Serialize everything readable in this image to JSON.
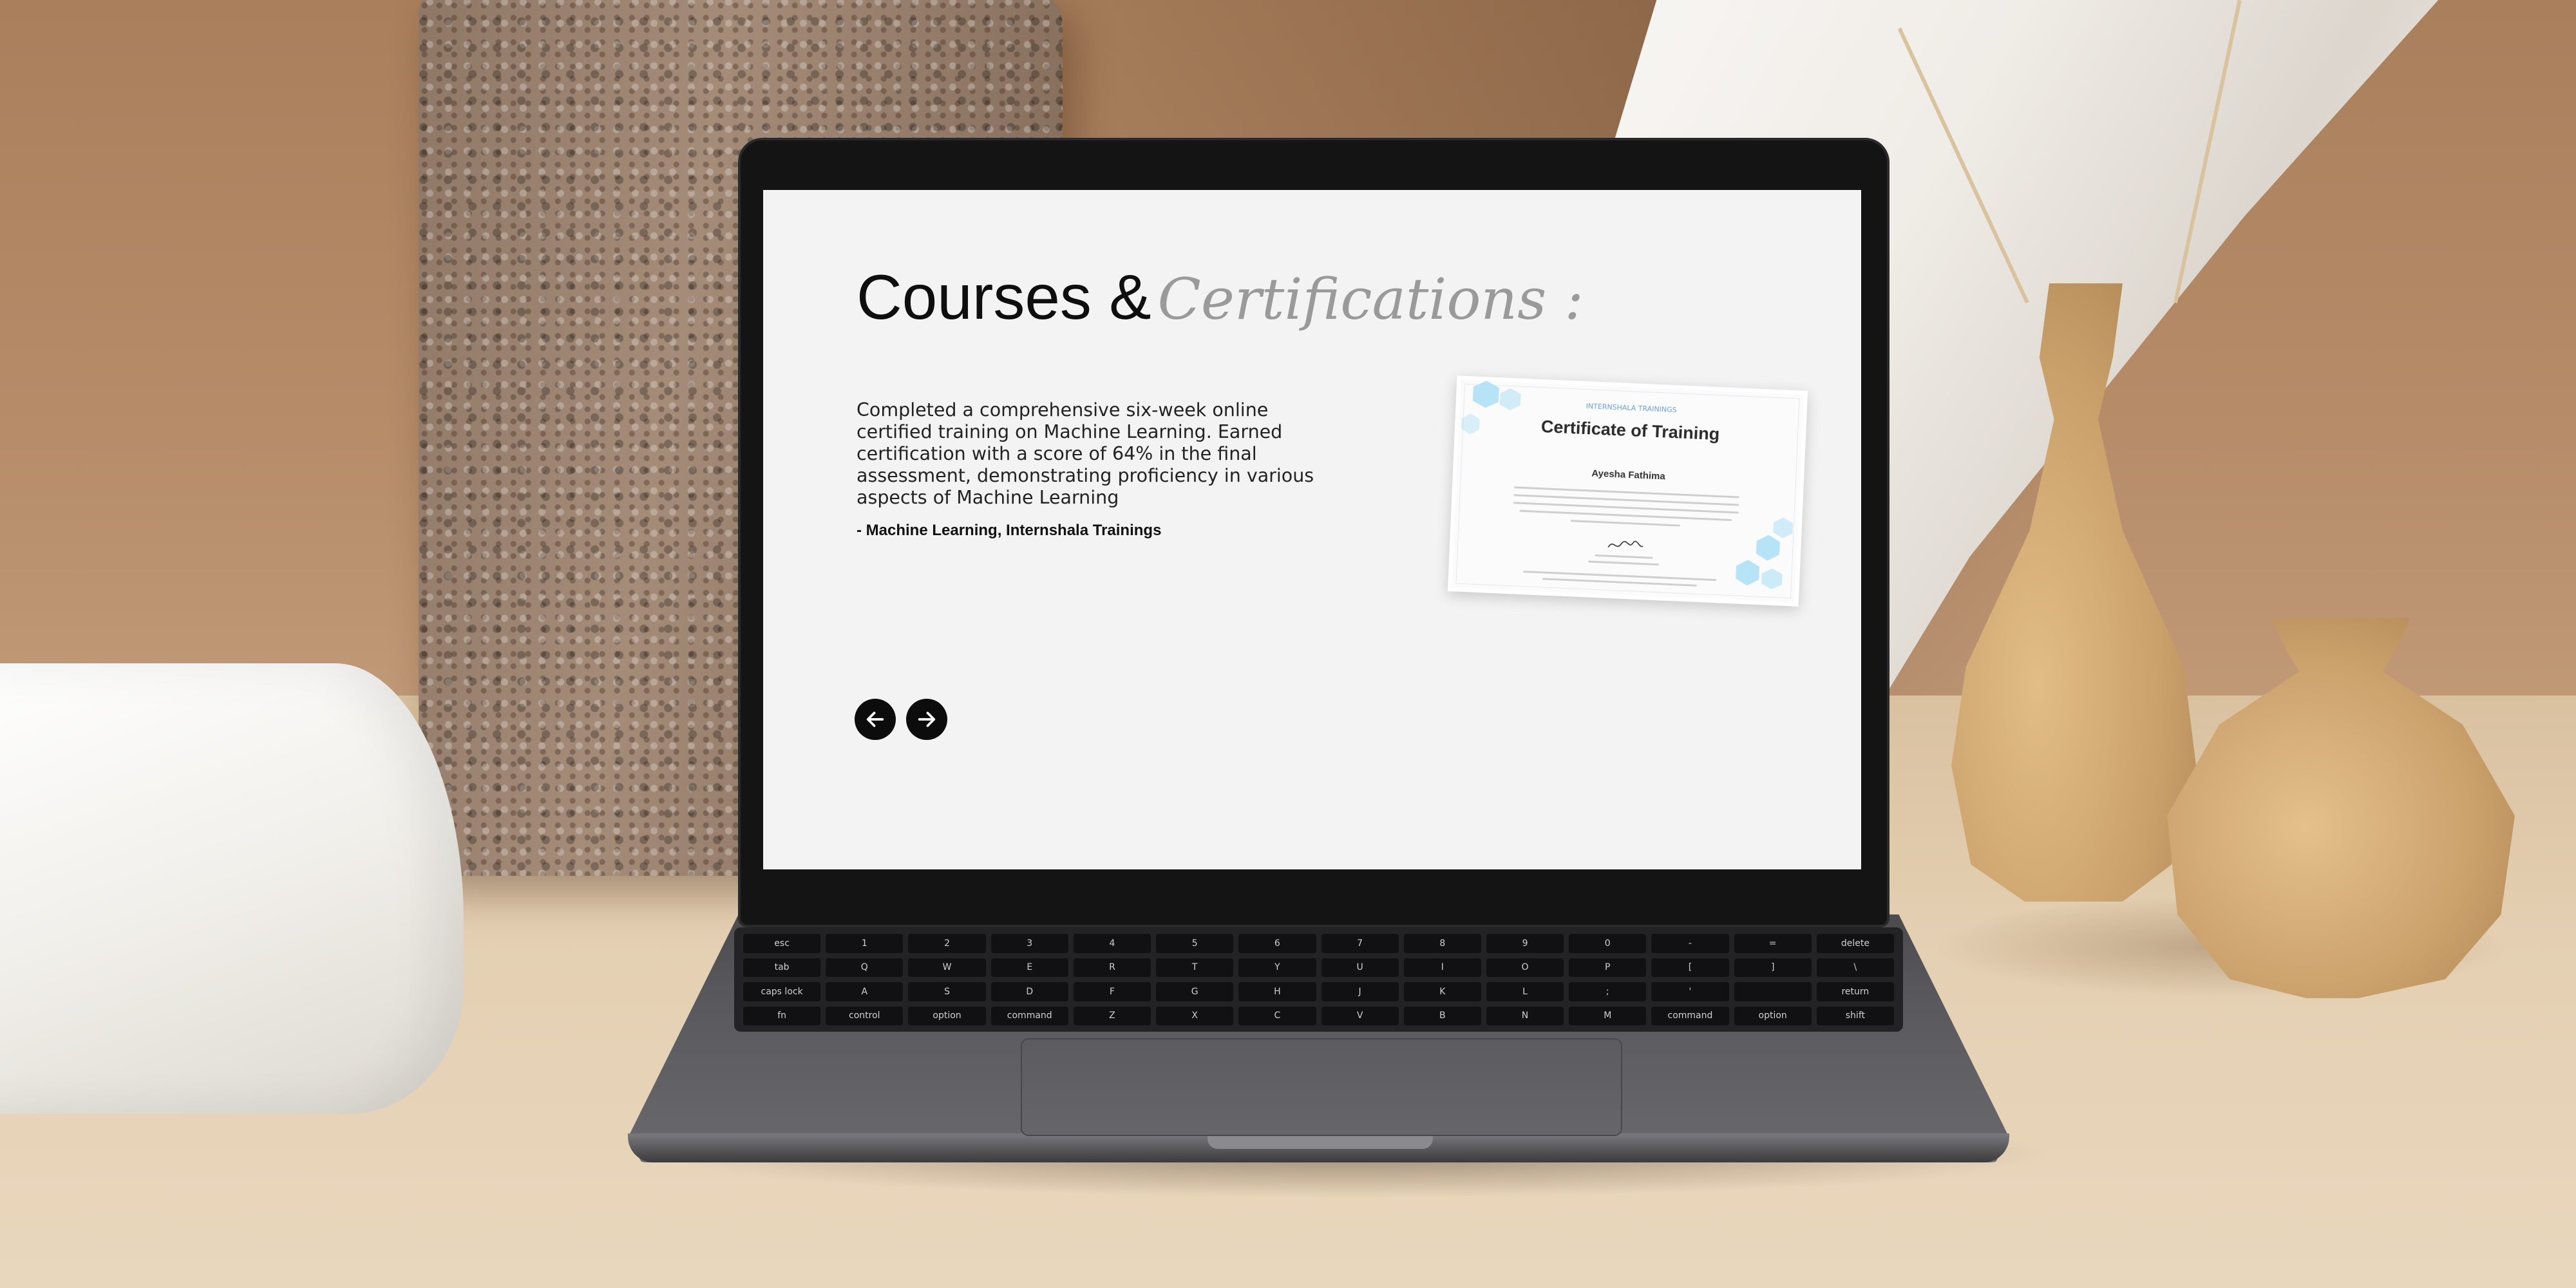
{
  "page": {
    "title_main": "Courses &",
    "title_accent": "Certifications :",
    "description": "Completed a comprehensive six-week online certified training on Machine Learning. Earned certification with a score of 64% in the final assessment, demonstrating proficiency in various aspects of Machine Learning",
    "source": "- Machine Learning, Internshala Trainings",
    "nav": {
      "prev_icon": "arrow-left-icon",
      "next_icon": "arrow-right-icon"
    }
  },
  "certificate": {
    "brand": "INTERNSHALA TRAININGS",
    "title": "Certificate of Training",
    "name": "Ayesha Fathima"
  },
  "colors": {
    "screen_bg": "#f3f3f3",
    "heading": "#0e0e0e",
    "heading_accent": "#9a9a9a",
    "nav_button": "#0c0c0c",
    "cert_accent": "#aee0f5"
  },
  "keyboard": {
    "rows": [
      [
        "esc",
        "1",
        "2",
        "3",
        "4",
        "5",
        "6",
        "7",
        "8",
        "9",
        "0",
        "-",
        "=",
        "delete"
      ],
      [
        "tab",
        "Q",
        "W",
        "E",
        "R",
        "T",
        "Y",
        "U",
        "I",
        "O",
        "P",
        "[",
        "]",
        "\\"
      ],
      [
        "caps lock",
        "A",
        "S",
        "D",
        "F",
        "G",
        "H",
        "J",
        "K",
        "L",
        ";",
        "'",
        "",
        "return"
      ],
      [
        "fn",
        "control",
        "option",
        "command",
        "Z",
        "X",
        "C",
        "V",
        "B",
        "N",
        "M",
        "command",
        "option",
        "shift"
      ]
    ]
  }
}
